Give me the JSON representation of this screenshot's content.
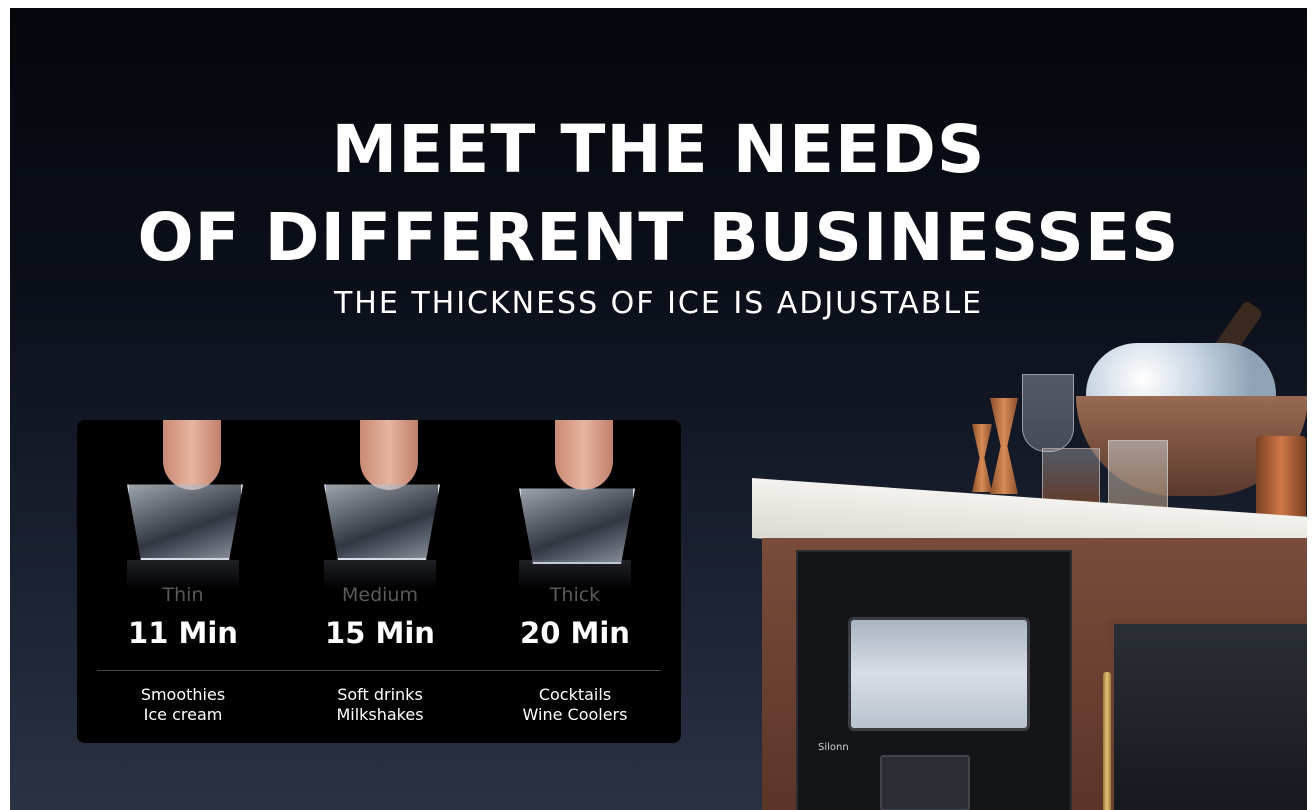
{
  "headline": {
    "line1": "MEET THE NEEDS",
    "line2": "OF DIFFERENT BUSINESSES"
  },
  "subheadline": "THE THICKNESS OF ICE IS ADJUSTABLE",
  "ice_options": [
    {
      "level": "Thin",
      "time": "11 Min",
      "uses": [
        "Smoothies",
        "Ice cream"
      ]
    },
    {
      "level": "Medium",
      "time": "15 Min",
      "uses": [
        "Soft drinks",
        "Milkshakes"
      ]
    },
    {
      "level": "Thick",
      "time": "20 Min",
      "uses": [
        "Cocktails",
        "Wine Coolers"
      ]
    }
  ],
  "product": {
    "brand": "Silonn"
  },
  "colors": {
    "background_top": "#05070c",
    "background_bottom": "#2a3244",
    "card": "#000000",
    "text": "#ffffff",
    "level_text": "#5a5a5a",
    "cabinet": "#6b4131"
  }
}
